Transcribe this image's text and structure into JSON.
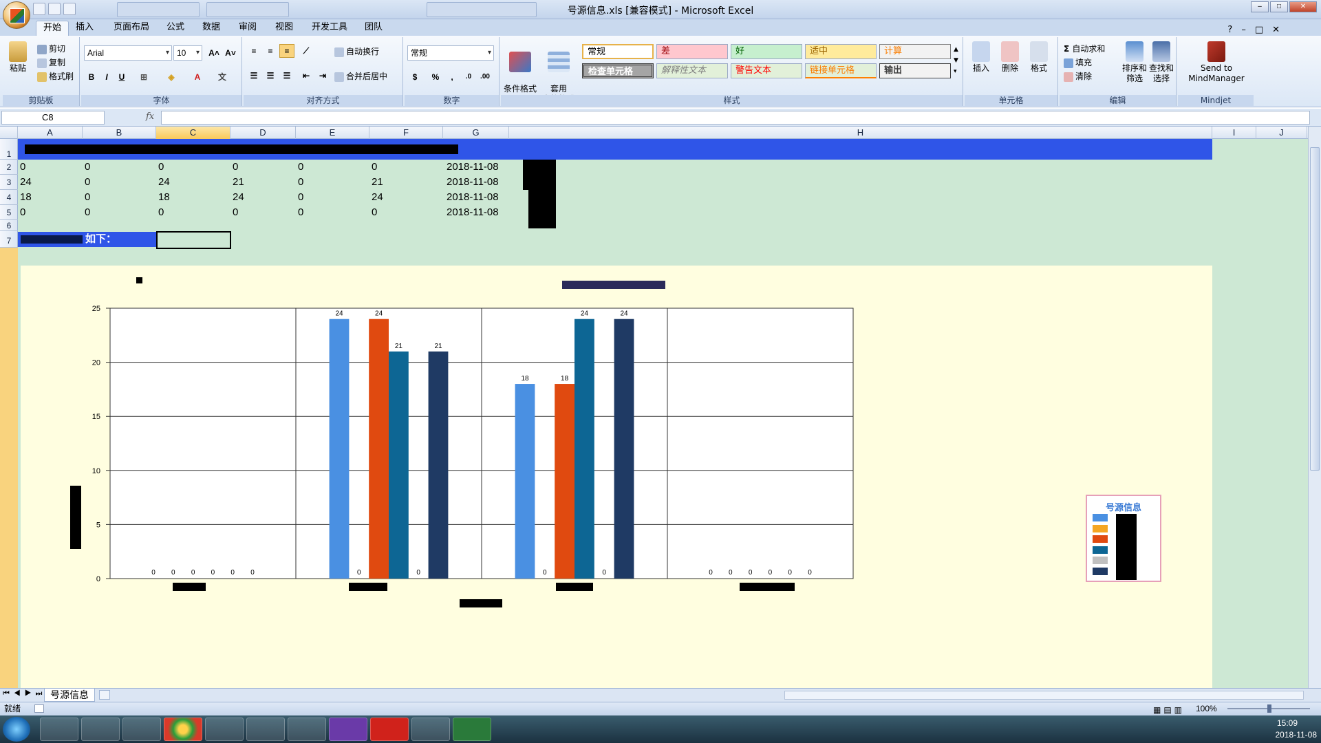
{
  "window": {
    "title": "号源信息.xls  [兼容模式] - Microsoft Excel"
  },
  "ribbon": {
    "tabs": [
      "开始",
      "插入",
      "页面布局",
      "公式",
      "数据",
      "审阅",
      "视图",
      "开发工具",
      "团队"
    ],
    "clipboard": {
      "paste": "粘贴",
      "cut": "剪切",
      "copy": "复制",
      "format_painter": "格式刷",
      "label": "剪贴板"
    },
    "font": {
      "name": "Arial",
      "size": "10",
      "label": "字体"
    },
    "alignment": {
      "wrap": "自动换行",
      "merge": "合并后居中",
      "label": "对齐方式"
    },
    "number": {
      "format": "常规",
      "label": "数字"
    },
    "styles": {
      "conditional": "条件格式",
      "table_format": "套用\n表格格式",
      "label": "样式",
      "cells": [
        "常规",
        "差",
        "好",
        "适中",
        "计算",
        "检查单元格",
        "解释性文本",
        "警告文本",
        "链接单元格",
        "输出"
      ]
    },
    "cells": {
      "insert": "插入",
      "delete": "删除",
      "format": "格式",
      "label": "单元格"
    },
    "editing": {
      "autosum": "自动求和",
      "fill": "填充",
      "clear": "清除",
      "sort": "排序和\n筛选",
      "find": "查找和\n选择",
      "label": "编辑"
    },
    "mindjet": {
      "send": "Send to\nMindManager",
      "label": "Mindjet"
    }
  },
  "formula_bar": {
    "name_box": "C8",
    "fx": "fx",
    "value": ""
  },
  "columns": [
    "A",
    "B",
    "C",
    "D",
    "E",
    "F",
    "G",
    "H",
    "I",
    "J"
  ],
  "rows": [
    "1",
    "2",
    "3",
    "4",
    "5",
    "6",
    "7"
  ],
  "table": {
    "rows": [
      [
        "0",
        "0",
        "0",
        "0",
        "0",
        "0",
        "2018-11-08"
      ],
      [
        "24",
        "0",
        "24",
        "21",
        "0",
        "21",
        "2018-11-08"
      ],
      [
        "18",
        "0",
        "18",
        "24",
        "0",
        "24",
        "2018-11-08"
      ],
      [
        "0",
        "0",
        "0",
        "0",
        "0",
        "0",
        "2018-11-08"
      ]
    ],
    "row7_text": "如下："
  },
  "chart_data": {
    "type": "bar",
    "categories": [
      "",
      "",
      "",
      ""
    ],
    "series": [
      {
        "values": [
          0,
          24,
          18,
          0
        ],
        "color": "#4a90e2"
      },
      {
        "values": [
          0,
          0,
          0,
          0
        ],
        "color": "#f5a623"
      },
      {
        "values": [
          0,
          24,
          18,
          0
        ],
        "color": "#e04a10"
      },
      {
        "values": [
          0,
          21,
          24,
          0
        ],
        "color": "#0d6694"
      },
      {
        "values": [
          0,
          0,
          0,
          0
        ],
        "color": "#c0c0c0"
      },
      {
        "values": [
          0,
          21,
          24,
          0
        ],
        "color": "#1f3a64"
      }
    ],
    "ylim": [
      0,
      25
    ],
    "yticks": [
      "0",
      "5",
      "10",
      "15",
      "20",
      "25"
    ],
    "legend_title": "号源信息",
    "legend_position": "right",
    "grid": true
  },
  "sheet_tabs": {
    "active": "号源信息"
  },
  "status": {
    "ready": "就绪",
    "zoom": "100%"
  },
  "taskbar": {
    "time": "15:09",
    "date": "2018-11-08"
  }
}
